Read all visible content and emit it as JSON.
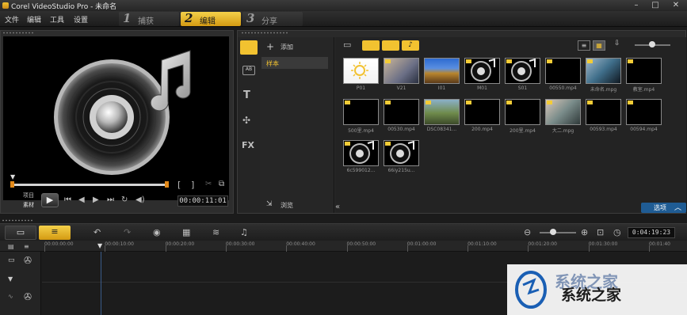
{
  "titlebar": {
    "title": "Corel VideoStudio Pro - 未命名",
    "minimize": "–",
    "maximize": "□",
    "close": "✕"
  },
  "menu": {
    "items": [
      "文件",
      "编辑",
      "工具",
      "设置"
    ]
  },
  "steps": [
    {
      "num": "1",
      "label": "捕获",
      "active": false
    },
    {
      "num": "2",
      "label": "编辑",
      "active": true
    },
    {
      "num": "3",
      "label": "分享",
      "active": false
    }
  ],
  "player": {
    "mode_project": "项目",
    "mode_clip": "素材",
    "mark_in": "[",
    "mark_out": "]",
    "timecode": "00:00:11:01"
  },
  "library": {
    "add_label": "添加",
    "folder_sample": "样本",
    "browse_label": "浏览",
    "options_label": "选项",
    "nav_icons": [
      "media-icon",
      "instant-project-icon",
      "title-icon",
      "transition-icon",
      "fx-icon"
    ],
    "nav_labels": [
      "T",
      "FX"
    ],
    "thumbnails": [
      {
        "label": "P01",
        "kind": "image-sun"
      },
      {
        "label": "V21",
        "kind": "video-people"
      },
      {
        "label": "I01",
        "kind": "image-landscape"
      },
      {
        "label": "M01",
        "kind": "audio"
      },
      {
        "label": "S01",
        "kind": "audio"
      },
      {
        "label": "00550.mp4",
        "kind": "black"
      },
      {
        "label": "未命名.mpg",
        "kind": "video-room"
      },
      {
        "label": "教室.mp4",
        "kind": "black"
      },
      {
        "label": "500里.mp4",
        "kind": "black"
      },
      {
        "label": "00530.mp4",
        "kind": "black"
      },
      {
        "label": "DSC08341...",
        "kind": "video-outdoor"
      },
      {
        "label": "200.mp4",
        "kind": "black"
      },
      {
        "label": "200里.mp4",
        "kind": "black"
      },
      {
        "label": "大二.mpg",
        "kind": "video-people2"
      },
      {
        "label": "00593.mp4",
        "kind": "black"
      },
      {
        "label": "00594.mp4",
        "kind": "black"
      },
      {
        "label": "6c599012...",
        "kind": "audio"
      },
      {
        "label": "66iy215u...",
        "kind": "audio"
      }
    ]
  },
  "timeline": {
    "total_time": "0:04:19:23",
    "ruler_labels": [
      "00:00:00:00",
      "00:00:10:00",
      "00:00:20:00",
      "00:00:30:00",
      "00:00:40:00",
      "00:00:50:00",
      "00:01:00:00",
      "00:01:10:00",
      "00:01:20:00",
      "00:01:30:00",
      "00:01:40"
    ]
  },
  "watermark": {
    "text": "系统之家"
  },
  "colors": {
    "accent_yellow": "#f2c230",
    "options_blue": "#1f5c94"
  }
}
